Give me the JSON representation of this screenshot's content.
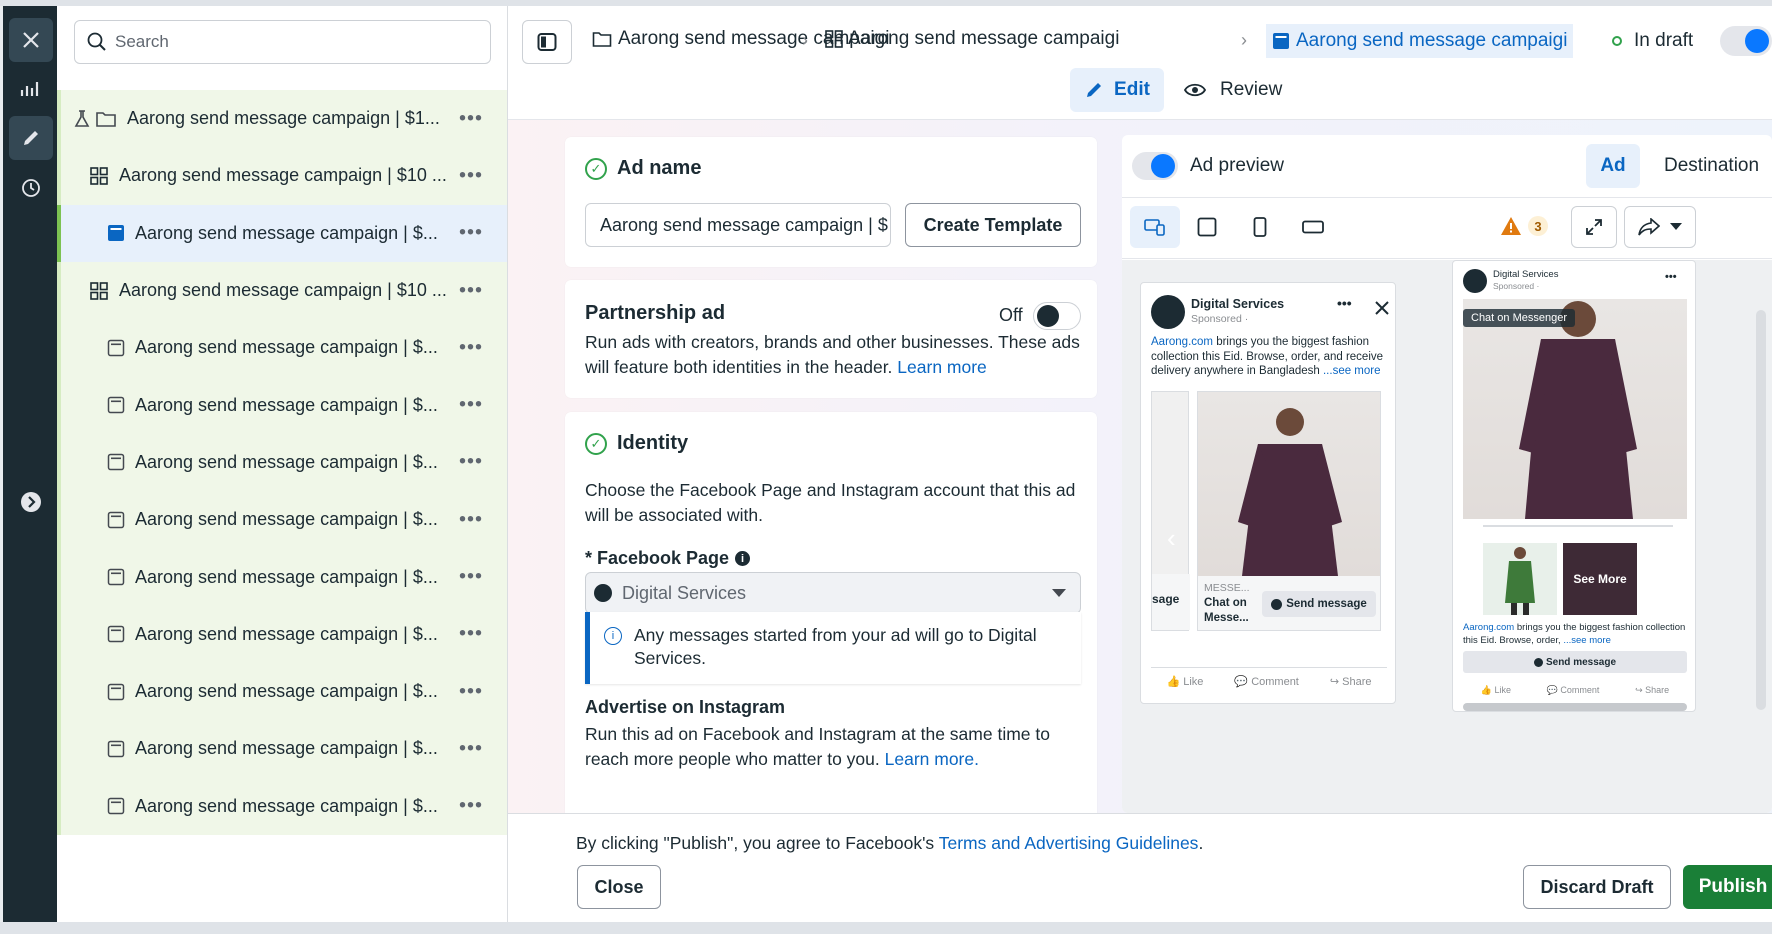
{
  "rail": {
    "items": [
      "close-icon",
      "chart-icon",
      "pencil-icon",
      "clock-icon",
      "chevron-right-icon"
    ]
  },
  "tree": {
    "search_placeholder": "Search",
    "rows": [
      {
        "label": "Aarong send message campaign | $1...",
        "kind": "campaign",
        "indent": 0
      },
      {
        "label": "Aarong send message campaign | $10 ...",
        "kind": "adset",
        "indent": 1
      },
      {
        "label": "Aarong send message campaign | $...",
        "kind": "ad-active",
        "indent": 2
      },
      {
        "label": "Aarong send message campaign | $10 ...",
        "kind": "adset",
        "indent": 1
      },
      {
        "label": "Aarong send message campaign | $...",
        "kind": "ad",
        "indent": 2
      },
      {
        "label": "Aarong send message campaign | $...",
        "kind": "ad",
        "indent": 2
      },
      {
        "label": "Aarong send message campaign | $...",
        "kind": "ad",
        "indent": 2
      },
      {
        "label": "Aarong send message campaign | $...",
        "kind": "ad",
        "indent": 2
      },
      {
        "label": "Aarong send message campaign | $...",
        "kind": "ad",
        "indent": 2
      },
      {
        "label": "Aarong send message campaign | $...",
        "kind": "ad",
        "indent": 2
      },
      {
        "label": "Aarong send message campaign | $...",
        "kind": "ad",
        "indent": 2
      },
      {
        "label": "Aarong send message campaign | $...",
        "kind": "ad",
        "indent": 2
      },
      {
        "label": "Aarong send message campaign | $...",
        "kind": "ad",
        "indent": 2
      }
    ],
    "more": "•••"
  },
  "topbar": {
    "crumbs": [
      "Aarong send message campaigi",
      "Aarong send message campaigi",
      "Aarong send message campaigi"
    ],
    "status": "In draft",
    "tab_edit": "Edit",
    "tab_review": "Review"
  },
  "ad_name": {
    "title": "Ad name",
    "value": "Aarong send message campaign | $",
    "create_template": "Create Template"
  },
  "partnership": {
    "title": "Partnership ad",
    "toggle_label": "Off",
    "desc": "Run ads with creators, brands and other businesses. These ads will feature both identities in the header.",
    "learn_more": "Learn more"
  },
  "identity": {
    "title": "Identity",
    "desc": "Choose the Facebook Page and Instagram account that this ad will be associated with.",
    "fb_page_label": "* Facebook Page",
    "fb_page_value": "Digital Services",
    "info_msg": "Any messages started from your ad will go to Digital Services.",
    "ig_title": "Advertise on Instagram",
    "ig_desc": "Run this ad on Facebook and Instagram at the same time to reach more people who matter to you.",
    "ig_learn_more": "Learn more."
  },
  "preview": {
    "label": "Ad preview",
    "tab_ad": "Ad",
    "tab_destination": "Destination",
    "warning_count": "3",
    "card1": {
      "page": "Digital Services",
      "sponsored": "Sponsored · ",
      "text_link": "Aarong.com",
      "text": " brings you the biggest fashion collection this Eid. Browse, order, and receive delivery anywhere in Bangladesh",
      "see_more": "...see more",
      "left_cta": "sage",
      "msg_label": "MESSE...",
      "chat_label": "Chat on Messe...",
      "send": "Send message",
      "like": "Like",
      "comment": "Comment",
      "share": "Share"
    },
    "card2": {
      "page": "Digital Services",
      "sponsored": "Sponsored · ",
      "chat_badge": "Chat on Messenger",
      "see_more_tile": "See More",
      "text_link": "Aarong.com",
      "text": " brings you the biggest fashion collection this Eid. Browse, order,",
      "see_more": "...see more",
      "send": "Send message",
      "like": "Like",
      "comment": "Comment",
      "share": "Share"
    }
  },
  "footer": {
    "agree_prefix": "By clicking \"Publish\", you agree to Facebook's ",
    "agree_link": "Terms and Advertising Guidelines",
    "agree_suffix": ".",
    "close": "Close",
    "discard": "Discard Draft",
    "publish": "Publish"
  },
  "colors": {
    "accent": "#0a66c2",
    "publish": "#1a7f37",
    "rail": "#1c2b33",
    "tree_bg": "#f0f7e8"
  }
}
